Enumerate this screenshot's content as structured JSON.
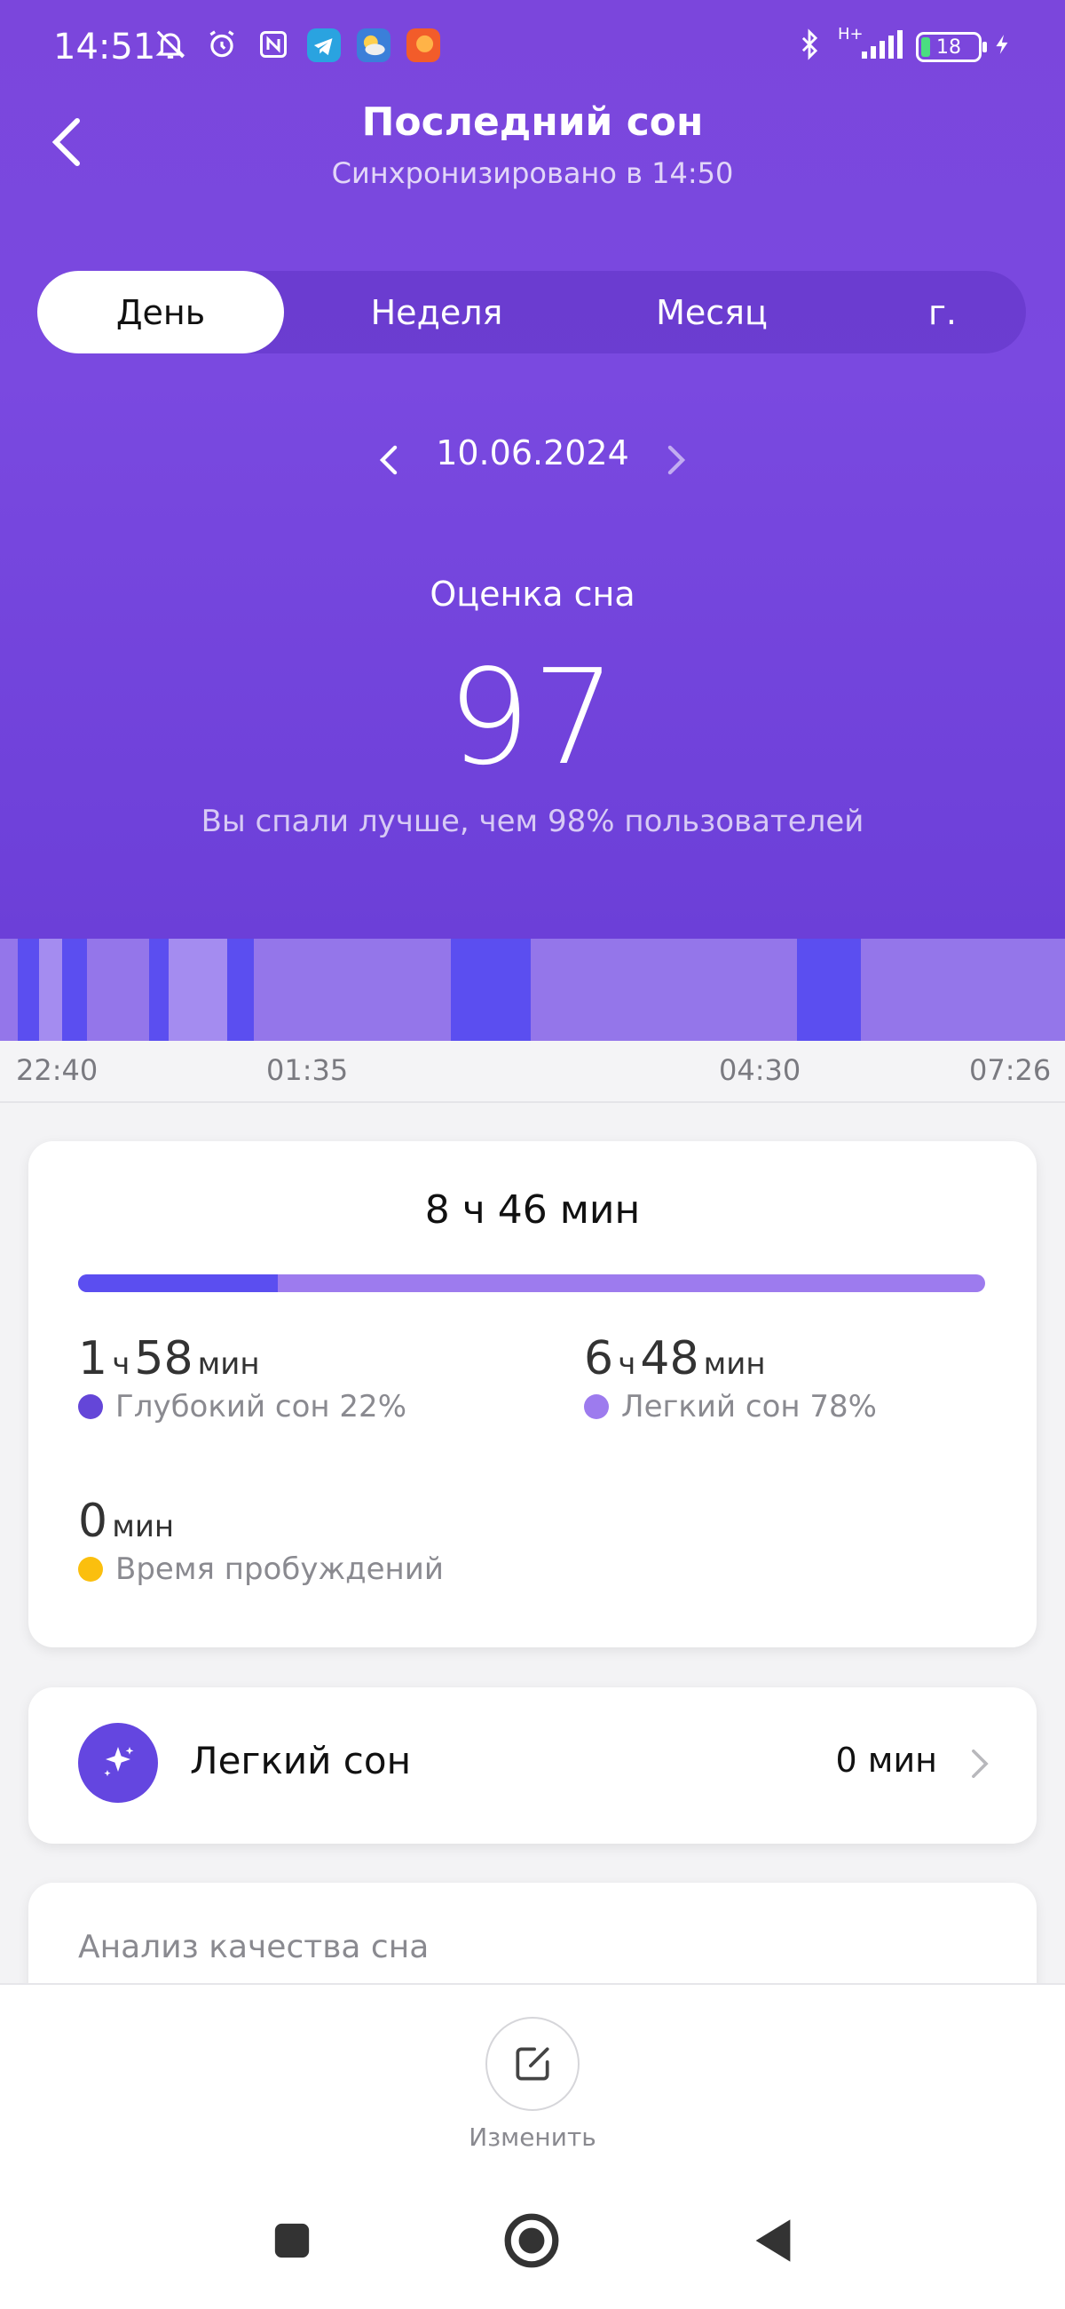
{
  "status_bar": {
    "time": "14:51",
    "battery": "18",
    "network": "H+"
  },
  "header": {
    "title": "Последний сон",
    "subtitle": "Синхронизировано в 14:50"
  },
  "tabs": [
    {
      "label": "День",
      "active": true
    },
    {
      "label": "Неделя",
      "active": false
    },
    {
      "label": "Месяц",
      "active": false
    },
    {
      "label": "г.",
      "active": false
    }
  ],
  "date_nav": {
    "date": "10.06.2024"
  },
  "score": {
    "label": "Оценка сна",
    "value": "97",
    "description": "Вы спали лучше, чем 98% пользователей"
  },
  "timeline": {
    "ticks": [
      "22:40",
      "01:35",
      "04:30",
      "07:26"
    ],
    "colors": {
      "deep": "#5b4ef0",
      "light": "#9476ea",
      "light_alt": "#a890f0"
    }
  },
  "summary": {
    "total": "8 ч 46 мин",
    "deep_fraction": 0.22,
    "deep": {
      "hours": "1",
      "h_unit": "ч",
      "minutes": "58",
      "m_unit": "мин",
      "label": "Глубокий сон 22%",
      "color": "#6446d8"
    },
    "light": {
      "hours": "6",
      "h_unit": "ч",
      "minutes": "48",
      "m_unit": "мин",
      "label": "Легкий сон 78%",
      "color": "#9d7bee"
    },
    "awake": {
      "minutes": "0",
      "m_unit": "мин",
      "label": "Время пробуждений",
      "color": "#fbbf0e"
    }
  },
  "row": {
    "label": "Легкий сон",
    "value": "0 мин",
    "icon": "sparkle-icon"
  },
  "analysis": {
    "title": "Анализ качества сна"
  },
  "bottom": {
    "edit_label": "Изменить"
  }
}
